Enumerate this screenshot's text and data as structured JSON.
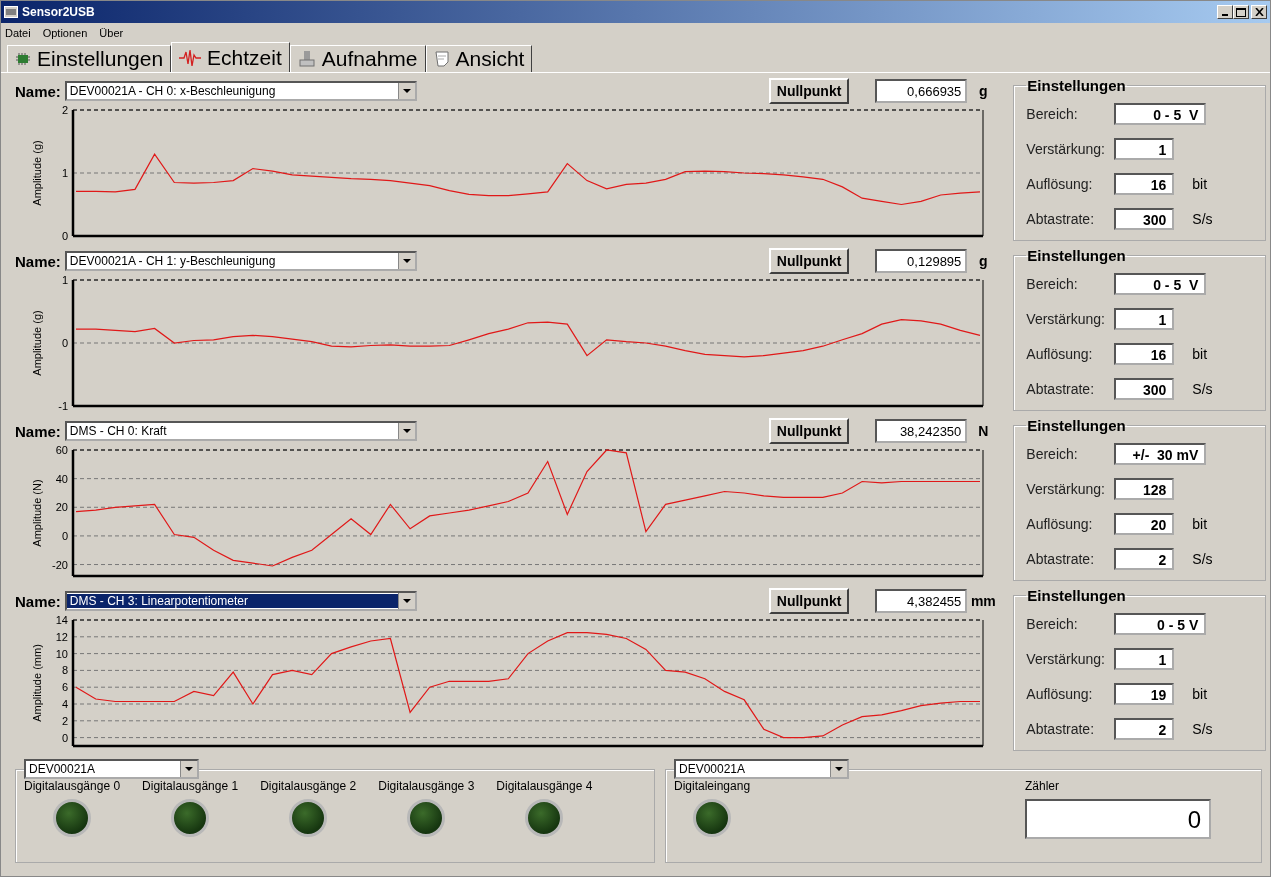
{
  "window": {
    "title": "Sensor2USB"
  },
  "menu": [
    {
      "label": "Datei"
    },
    {
      "label": "Optionen"
    },
    {
      "label": "Über"
    }
  ],
  "tabs": [
    {
      "label": "Einstellungen",
      "selected": false
    },
    {
      "label": "Echtzeit",
      "selected": true
    },
    {
      "label": "Aufnahme",
      "selected": false
    },
    {
      "label": "Ansicht",
      "selected": false
    }
  ],
  "channels": [
    {
      "name_label": "Name:",
      "device": "DEV00021A - CH 0: x-Beschleunigung",
      "highlighted": false,
      "zero_button": "Nullpunkt",
      "reading": "0,666935",
      "unit": "g",
      "chart_data": {
        "type": "line",
        "grid": true,
        "ylabel": "Amplitude (g)",
        "ylim": [
          0,
          2
        ],
        "yticks": [
          0,
          1,
          2
        ],
        "values": [
          0.71,
          0.71,
          0.7,
          0.74,
          1.3,
          0.85,
          0.84,
          0.85,
          0.88,
          1.07,
          1.03,
          0.97,
          0.95,
          0.93,
          0.91,
          0.9,
          0.88,
          0.84,
          0.8,
          0.72,
          0.66,
          0.64,
          0.64,
          0.67,
          0.7,
          1.15,
          0.88,
          0.75,
          0.82,
          0.84,
          0.9,
          1.02,
          1.03,
          1.02,
          1.0,
          0.99,
          0.97,
          0.94,
          0.9,
          0.78,
          0.6,
          0.55,
          0.5,
          0.55,
          0.65,
          0.68,
          0.7
        ]
      },
      "settings": {
        "title": "Einstellungen",
        "rows": [
          {
            "label": "Bereich:",
            "value": "0 - 5  V",
            "unit": ""
          },
          {
            "label": "Verstärkung:",
            "value": "1",
            "unit": ""
          },
          {
            "label": "Auflösung:",
            "value": "16",
            "unit": "bit"
          },
          {
            "label": "Abtastrate:",
            "value": "300",
            "unit": "S/s"
          }
        ]
      }
    },
    {
      "name_label": "Name:",
      "device": "DEV00021A - CH 1: y-Beschleunigung",
      "highlighted": false,
      "zero_button": "Nullpunkt",
      "reading": "0,129895",
      "unit": "g",
      "chart_data": {
        "type": "line",
        "grid": true,
        "ylabel": "Amplitude (g)",
        "ylim": [
          -1,
          1
        ],
        "yticks": [
          -1,
          0,
          1
        ],
        "values": [
          0.22,
          0.22,
          0.2,
          0.18,
          0.23,
          0.0,
          0.04,
          0.05,
          0.1,
          0.12,
          0.1,
          0.06,
          0.02,
          -0.05,
          -0.06,
          -0.04,
          -0.03,
          -0.05,
          -0.05,
          -0.04,
          0.05,
          0.15,
          0.22,
          0.32,
          0.33,
          0.3,
          -0.2,
          0.05,
          0.02,
          0.0,
          -0.05,
          -0.12,
          -0.18,
          -0.2,
          -0.22,
          -0.2,
          -0.16,
          -0.12,
          -0.05,
          0.05,
          0.15,
          0.3,
          0.37,
          0.35,
          0.3,
          0.2,
          0.12
        ]
      },
      "settings": {
        "title": "Einstellungen",
        "rows": [
          {
            "label": "Bereich:",
            "value": "0 - 5  V",
            "unit": ""
          },
          {
            "label": "Verstärkung:",
            "value": "1",
            "unit": ""
          },
          {
            "label": "Auflösung:",
            "value": "16",
            "unit": "bit"
          },
          {
            "label": "Abtastrate:",
            "value": "300",
            "unit": "S/s"
          }
        ]
      }
    },
    {
      "name_label": "Name:",
      "device": "DMS - CH 0: Kraft",
      "highlighted": false,
      "zero_button": "Nullpunkt",
      "reading": "38,242350",
      "unit": "N",
      "chart_data": {
        "type": "line",
        "grid": true,
        "ylabel": "Amplitude (N)",
        "ylim": [
          -28,
          60
        ],
        "yticks": [
          -20,
          0,
          20,
          40,
          60
        ],
        "values": [
          17,
          18,
          20,
          21,
          22,
          1,
          -1,
          -10,
          -17,
          -19,
          -21,
          -15,
          -10,
          1,
          12,
          1,
          22,
          5,
          14,
          16,
          18,
          21,
          24,
          30,
          52,
          15,
          45,
          60,
          58,
          3,
          22,
          25,
          28,
          31,
          30,
          28,
          27,
          27,
          27,
          30,
          38,
          37,
          38,
          38,
          38,
          38,
          38
        ]
      },
      "settings": {
        "title": "Einstellungen",
        "rows": [
          {
            "label": "Bereich:",
            "value": "+/-  30 mV",
            "unit": ""
          },
          {
            "label": "Verstärkung:",
            "value": "128",
            "unit": ""
          },
          {
            "label": "Auflösung:",
            "value": "20",
            "unit": "bit"
          },
          {
            "label": "Abtastrate:",
            "value": "2",
            "unit": "S/s"
          }
        ]
      }
    },
    {
      "name_label": "Name:",
      "device": "DMS - CH 3: Linearpotentiometer",
      "highlighted": true,
      "zero_button": "Nullpunkt",
      "reading": "4,382455",
      "unit": "mm",
      "chart_data": {
        "type": "line",
        "grid": true,
        "ylabel": "Amplitude (mm)",
        "ylim": [
          -1,
          14
        ],
        "yticks": [
          0,
          2,
          4,
          6,
          8,
          10,
          12,
          14
        ],
        "values": [
          6,
          4.6,
          4.3,
          4.3,
          4.3,
          4.3,
          5.5,
          5,
          7.8,
          4,
          7.5,
          8,
          7.5,
          10,
          10.8,
          11.5,
          11.8,
          3,
          6,
          6.7,
          6.7,
          6.7,
          7,
          10,
          11.5,
          12.5,
          12.5,
          12.3,
          11.8,
          10.5,
          8,
          7.8,
          7,
          5.5,
          4.5,
          1,
          0,
          0,
          0.2,
          1.5,
          2.5,
          2.7,
          3.2,
          3.8,
          4.1,
          4.3,
          4.3
        ]
      },
      "settings": {
        "title": "Einstellungen",
        "rows": [
          {
            "label": "Bereich:",
            "value": "0 - 5 V",
            "unit": ""
          },
          {
            "label": "Verstärkung:",
            "value": "1",
            "unit": ""
          },
          {
            "label": "Auflösung:",
            "value": "19",
            "unit": "bit"
          },
          {
            "label": "Abtastrate:",
            "value": "2",
            "unit": "S/s"
          }
        ]
      }
    }
  ],
  "outputs": {
    "device": "DEV00021A",
    "leds": [
      {
        "label": "Digitalausgänge 0",
        "on": false
      },
      {
        "label": "Digitalausgänge 1",
        "on": false
      },
      {
        "label": "Digitalausgänge 2",
        "on": false
      },
      {
        "label": "Digitalausgänge 3",
        "on": false
      },
      {
        "label": "Digitalausgänge 4",
        "on": false
      }
    ]
  },
  "inputs": {
    "device": "DEV00021A",
    "leds": [
      {
        "label": "Digitaleingang",
        "on": false
      }
    ],
    "counter": {
      "label": "Zähler",
      "value": "0"
    }
  }
}
